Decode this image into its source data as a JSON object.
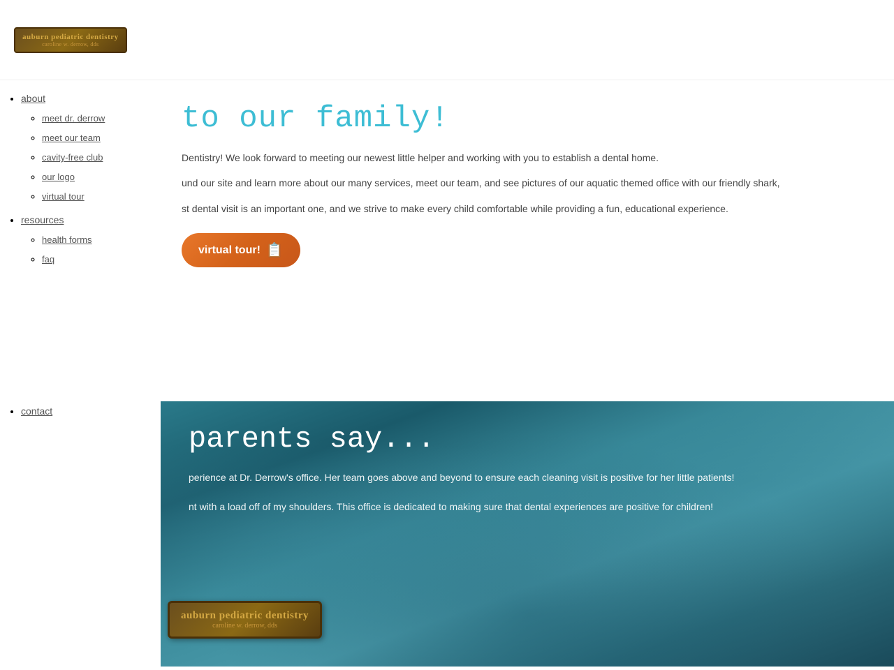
{
  "header": {
    "logo_main": "auburn pediatric dentistry",
    "logo_sub": "caroline w. derrow, dds"
  },
  "nav": {
    "items": [
      {
        "label": "about",
        "subitems": [
          {
            "label": "meet dr. derrow"
          },
          {
            "label": "meet our team"
          },
          {
            "label": "cavity-free club"
          },
          {
            "label": "our logo"
          },
          {
            "label": "virtual tour"
          }
        ]
      },
      {
        "label": "resources",
        "subitems": [
          {
            "label": "health forms"
          },
          {
            "label": "faq"
          }
        ]
      },
      {
        "label": "contact",
        "subitems": []
      }
    ]
  },
  "welcome": {
    "title": "to our family!",
    "para1": "Dentistry! We look forward to meeting our newest little helper and working with you to establish a dental home.",
    "para2": "und our site and learn more about our many services, meet our team, and see pictures of our aquatic themed office with our friendly shark,",
    "para3": "st dental visit is an important one, and we strive to make every child comfortable while providing a fun, educational experience.",
    "virtual_tour_btn": "virtual tour!"
  },
  "parents_say": {
    "title": "parents say...",
    "testimonial1": "perience at Dr. Derrow's office. Her team goes above and beyond to ensure each cleaning visit is positive for her little patients!",
    "testimonial2": "nt with a load off of my shoulders. This office is dedicated to making sure that dental experiences are positive for children!"
  },
  "logo_watermark": {
    "main": "auburn pediatric dentistry",
    "sub": "caroline w. derrow, dds"
  }
}
